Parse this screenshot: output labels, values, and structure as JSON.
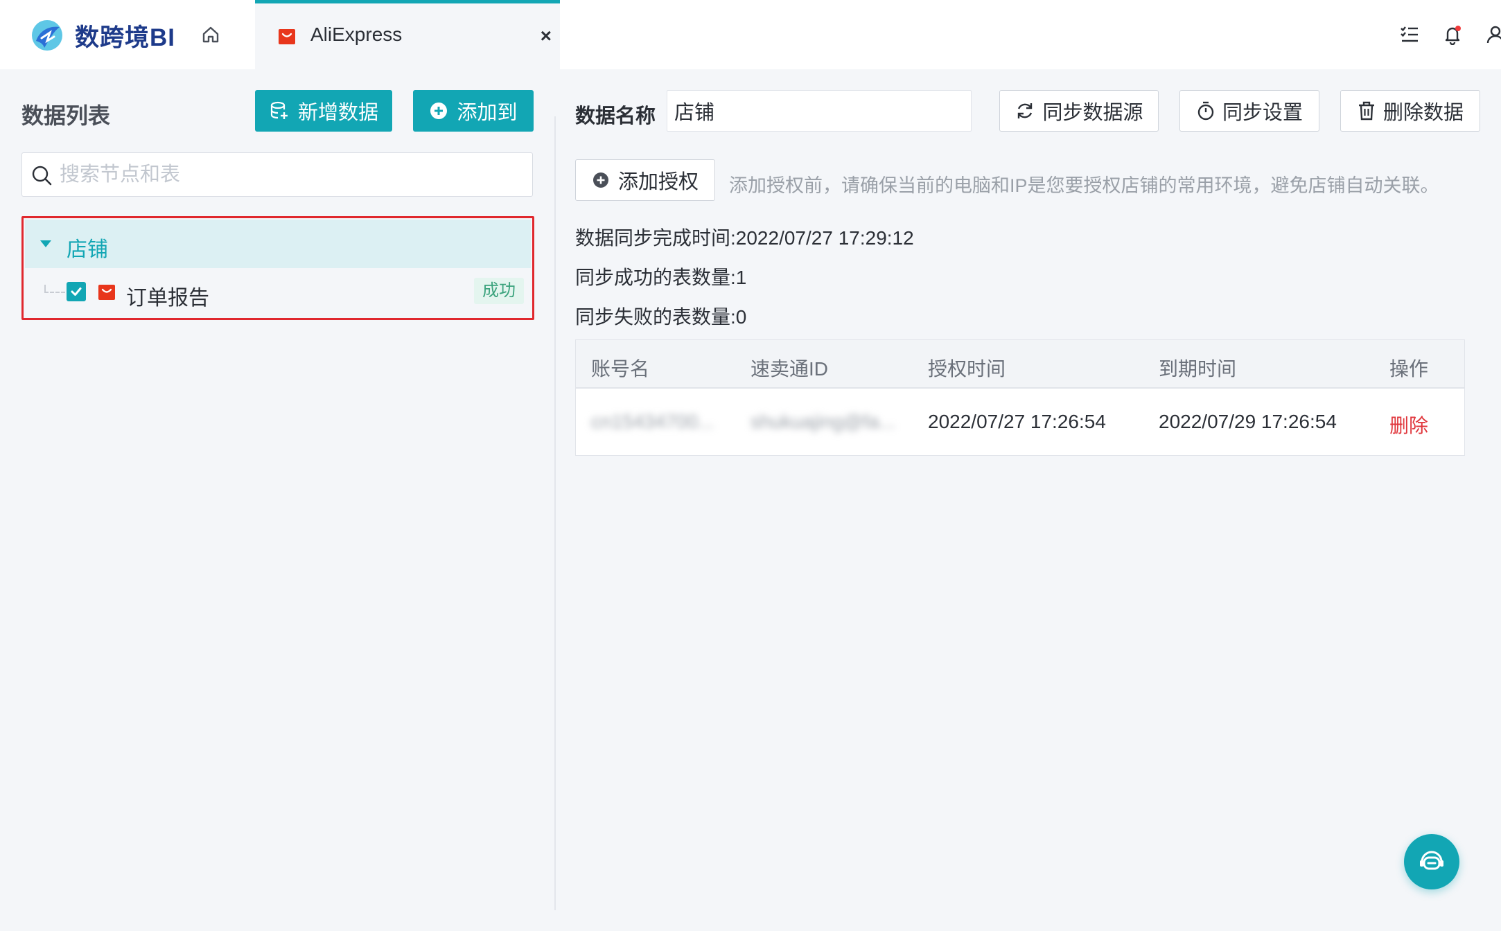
{
  "app": {
    "logo_text": "数跨境BI",
    "brand_color": "#12a6b4"
  },
  "tab": {
    "label": "AliExpress",
    "close": "×",
    "icon": "aliexpress-bag-icon"
  },
  "left": {
    "title": "数据列表",
    "add_data_label": "新增数据",
    "add_to_label": "添加到",
    "search_placeholder": "搜索节点和表",
    "tree": {
      "node_label": "店铺",
      "leaf_label": "订单报告",
      "leaf_status": "成功",
      "leaf_checked": true
    }
  },
  "right": {
    "name_label": "数据名称",
    "name_value": "店铺",
    "sync_source_label": "同步数据源",
    "sync_settings_label": "同步设置",
    "delete_data_label": "删除数据",
    "add_auth_label": "添加授权",
    "auth_hint": "添加授权前，请确保当前的电脑和IP是您要授权店铺的常用环境，避免店铺自动关联。",
    "sync_time_label": "数据同步完成时间:",
    "sync_time_value": "2022/07/27 17:29:12",
    "success_count_label": "同步成功的表数量:",
    "success_count_value": "1",
    "fail_count_label": "同步失败的表数量:",
    "fail_count_value": "0",
    "table": {
      "headers": [
        "账号名",
        "速卖通ID",
        "授权时间",
        "到期时间",
        "操作"
      ],
      "rows": [
        {
          "account": "cn15434700...",
          "aliexpress_id": "shukuajing@fa...",
          "auth_time": "2022/07/27 17:26:54",
          "expire_time": "2022/07/29 17:26:54",
          "action": "删除"
        }
      ]
    }
  }
}
